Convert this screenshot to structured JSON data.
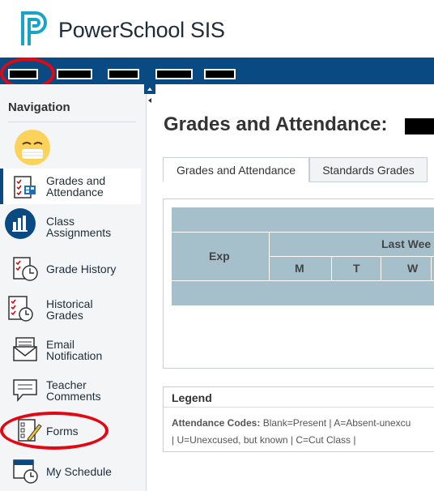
{
  "app": {
    "title": "PowerSchool SIS",
    "brand_color": "#0a4a83",
    "annotation_color": "#e30613"
  },
  "navbar": {
    "items": [
      "",
      "",
      "",
      "",
      ""
    ]
  },
  "sidebar": {
    "title": "Navigation",
    "items": [
      {
        "label_1": "Grades and",
        "label_2": "Attendance",
        "icon": "grades-attendance-icon"
      },
      {
        "label_1": "Class",
        "label_2": "Assignments",
        "icon": "class-assignments-icon"
      },
      {
        "label_1": "Grade History",
        "label_2": "",
        "icon": "grade-history-icon"
      },
      {
        "label_1": "Historical",
        "label_2": "Grades",
        "icon": "historical-grades-icon"
      },
      {
        "label_1": "Email",
        "label_2": "Notification",
        "icon": "email-icon"
      },
      {
        "label_1": "Teacher",
        "label_2": "Comments",
        "icon": "comments-icon"
      },
      {
        "label_1": "Forms",
        "label_2": "",
        "icon": "forms-icon"
      },
      {
        "label_1": "My Schedule",
        "label_2": "",
        "icon": "schedule-icon"
      }
    ]
  },
  "main": {
    "title": "Grades and Attendance:",
    "tabs": [
      {
        "label": "Grades and Attendance"
      },
      {
        "label": "Standards Grades"
      }
    ],
    "table": {
      "col_exp": "Exp",
      "group_header": "Last Wee",
      "days": [
        "M",
        "T",
        "W"
      ]
    },
    "legend": {
      "title": "Legend",
      "codes_label": "Attendance Codes:",
      "codes_line1": "Blank=Present | A=Absent-unexcu",
      "codes_line2": "| U=Unexcused, but known | C=Cut Class |"
    }
  }
}
